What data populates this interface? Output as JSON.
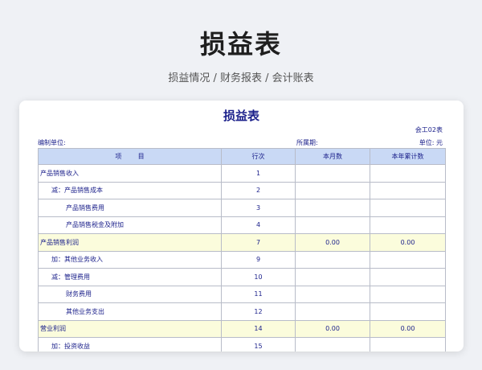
{
  "header": {
    "title": "损益表",
    "subtitle": "损益情况 / 财务报表 / 会计账表"
  },
  "report": {
    "title": "损益表",
    "form_code": "会工02表",
    "prepared_by_label": "编制单位:",
    "period_label": "所属期:",
    "unit_label": "单位:  元",
    "columns": [
      "项        目",
      "行次",
      "本月数",
      "本年累计数"
    ],
    "rows": [
      {
        "item": "产品销售收入",
        "line": "1",
        "month": "",
        "ytd": ""
      },
      {
        "item": "减：产品销售成本",
        "line": "2",
        "month": "",
        "ytd": ""
      },
      {
        "item": "产品销售费用",
        "line": "3",
        "month": "",
        "ytd": ""
      },
      {
        "item": "产品销售税金及附加",
        "line": "4",
        "month": "",
        "ytd": ""
      },
      {
        "item": "产品销售利润",
        "line": "7",
        "month": "0.00",
        "ytd": "0.00"
      },
      {
        "item": "加：其他业务收入",
        "line": "9",
        "month": "",
        "ytd": ""
      },
      {
        "item": "减：管理费用",
        "line": "10",
        "month": "",
        "ytd": ""
      },
      {
        "item": "财务费用",
        "line": "11",
        "month": "",
        "ytd": ""
      },
      {
        "item": "其他业务支出",
        "line": "12",
        "month": "",
        "ytd": ""
      },
      {
        "item": "营业利润",
        "line": "14",
        "month": "0.00",
        "ytd": "0.00"
      },
      {
        "item": "加：投资收益",
        "line": "15",
        "month": "",
        "ytd": ""
      }
    ]
  }
}
